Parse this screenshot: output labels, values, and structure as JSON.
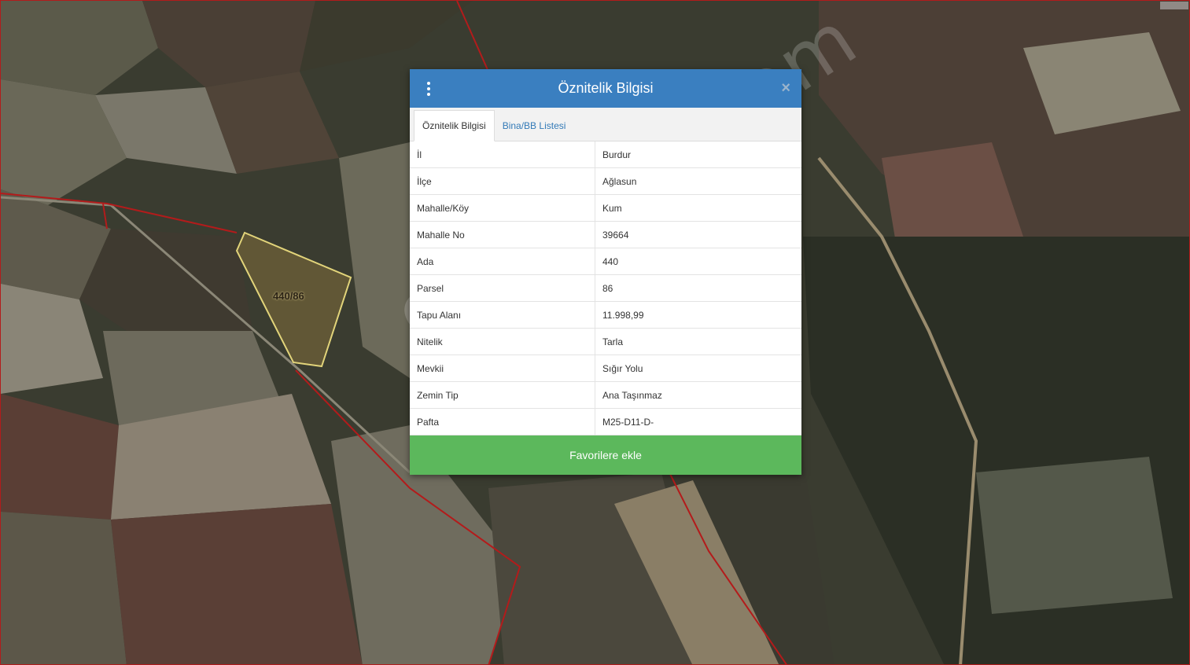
{
  "map": {
    "parcel_label": "440/86"
  },
  "watermark": "emlakjet.com",
  "dialog": {
    "title": "Öznitelik Bilgisi",
    "close_label": "×",
    "tabs": [
      {
        "label": "Öznitelik Bilgisi",
        "active": true
      },
      {
        "label": "Bina/BB Listesi",
        "active": false
      }
    ],
    "rows": [
      {
        "key": "İl",
        "value": "Burdur"
      },
      {
        "key": "İlçe",
        "value": "Ağlasun"
      },
      {
        "key": "Mahalle/Köy",
        "value": "Kum"
      },
      {
        "key": "Mahalle No",
        "value": "39664"
      },
      {
        "key": "Ada",
        "value": "440"
      },
      {
        "key": "Parsel",
        "value": "86"
      },
      {
        "key": "Tapu Alanı",
        "value": "11.998,99"
      },
      {
        "key": "Nitelik",
        "value": "Tarla"
      },
      {
        "key": "Mevkii",
        "value": "Sığır Yolu"
      },
      {
        "key": "Zemin Tip",
        "value": "Ana Taşınmaz"
      },
      {
        "key": "Pafta",
        "value": "M25-D11-D-"
      }
    ],
    "favorite_label": "Favorilere ekle"
  },
  "colors": {
    "header_blue": "#3a7fc0",
    "button_green": "#5cb85c",
    "parcel_outline": "#e2d47a",
    "boundary_red": "#b31b1b"
  }
}
